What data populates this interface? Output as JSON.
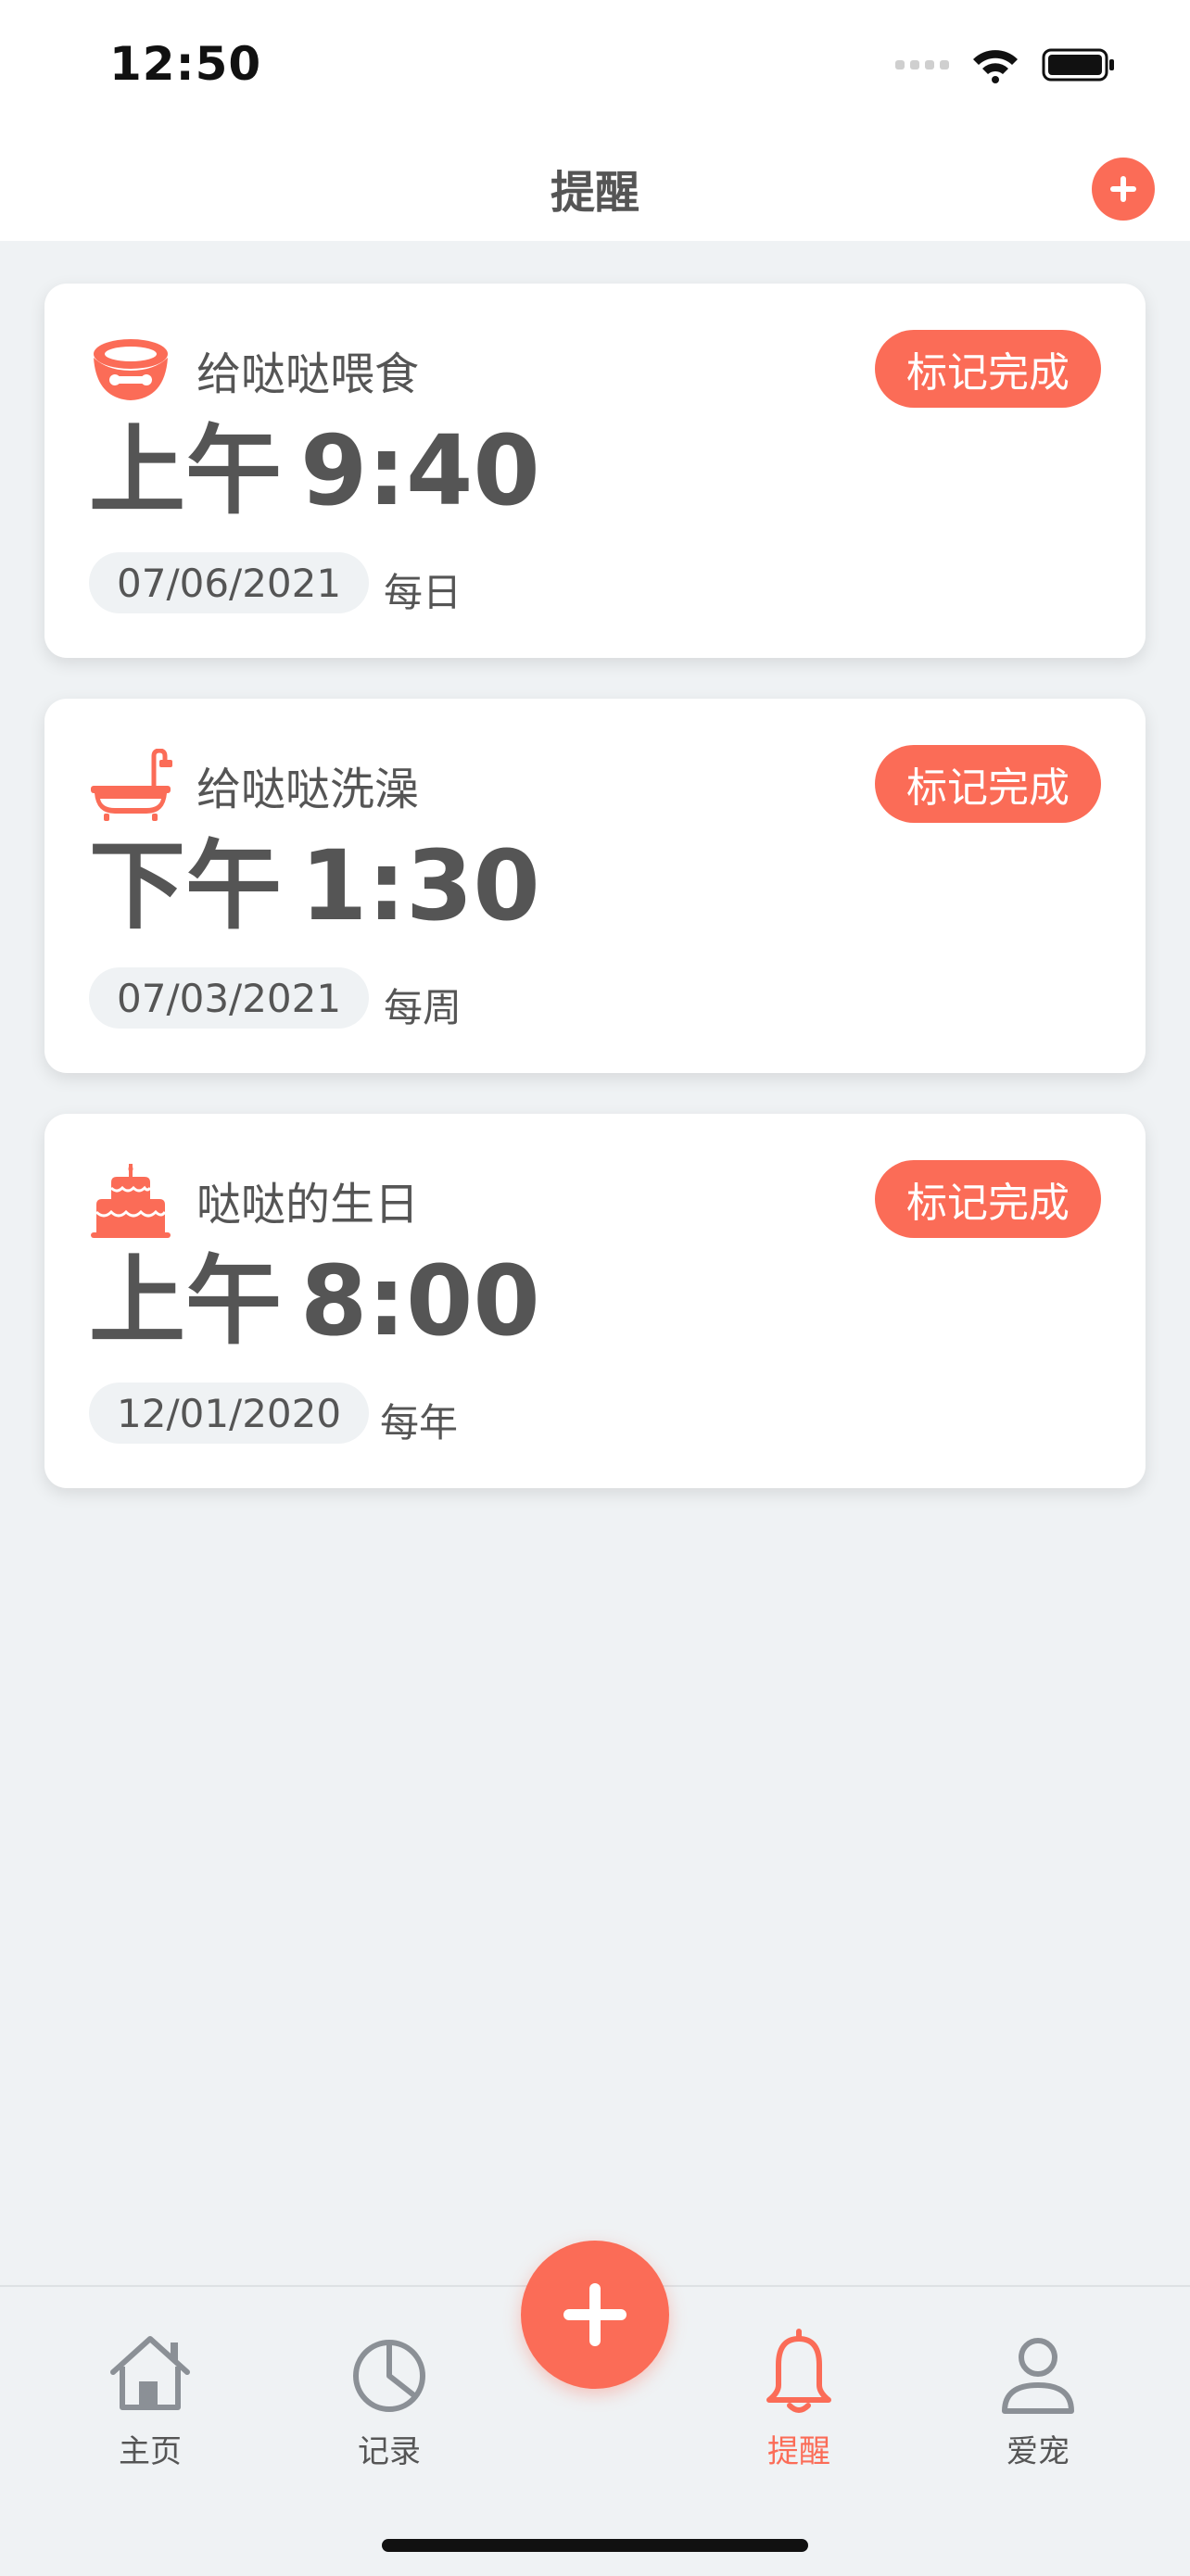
{
  "status_bar": {
    "time": "12:50"
  },
  "header": {
    "title": "提醒"
  },
  "reminders": [
    {
      "icon": "pet-bowl-icon",
      "title": "给哒哒喂食",
      "ampm": "上午",
      "time": "9:40",
      "date": "07/06/2021",
      "repeat": "每日",
      "action_label": "标记完成"
    },
    {
      "icon": "bathtub-icon",
      "title": "给哒哒洗澡",
      "ampm": "下午",
      "time": "1:30",
      "date": "07/03/2021",
      "repeat": "每周",
      "action_label": "标记完成"
    },
    {
      "icon": "birthday-cake-icon",
      "title": "哒哒的生日",
      "ampm": "上午",
      "time": "8:00",
      "date": "12/01/2020",
      "repeat": "每年",
      "action_label": "标记完成"
    }
  ],
  "tab_bar": {
    "items": [
      {
        "label": "主页",
        "icon": "home-icon"
      },
      {
        "label": "记录",
        "icon": "pie-chart-icon"
      },
      {
        "label": "提醒",
        "icon": "bell-icon",
        "active": true
      },
      {
        "label": "爱宠",
        "icon": "user-icon"
      }
    ]
  },
  "colors": {
    "accent": "#fb6c57",
    "background": "#eff2f4",
    "text": "#555555"
  }
}
